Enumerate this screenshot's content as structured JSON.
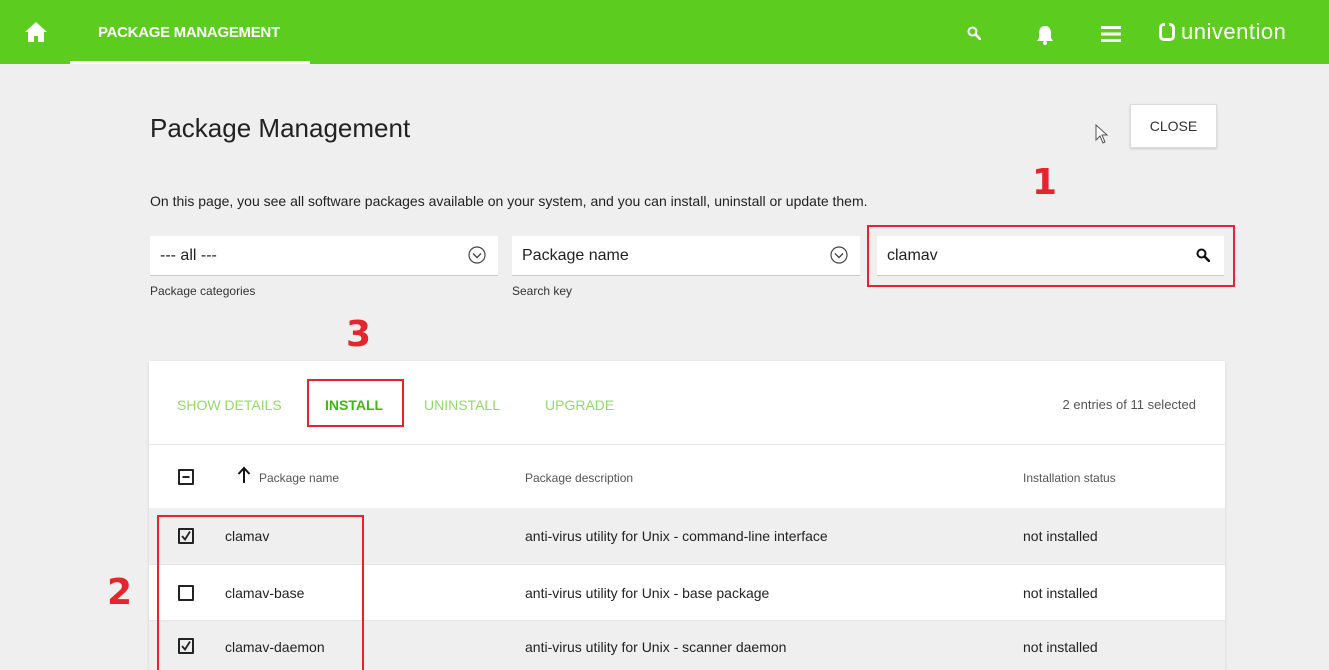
{
  "topbar": {
    "module_tab": "PACKAGE MANAGEMENT",
    "brand": "univention",
    "accent_color": "#5ccc1f",
    "icons": [
      "home-icon",
      "search-icon",
      "bell-icon",
      "menu-icon"
    ]
  },
  "page": {
    "title": "Package Management",
    "close_label": "CLOSE",
    "description": "On this page, you see all software packages available on your system, and you can install, uninstall or update them."
  },
  "filters": {
    "category": {
      "value": "--- all ---",
      "label": "Package categories"
    },
    "search_key": {
      "value": "Package name",
      "label": "Search key"
    },
    "search": {
      "value": "clamav"
    }
  },
  "annotations": {
    "step1": "1",
    "step2": "2",
    "step3": "3",
    "color": "#e2262b"
  },
  "toolbar": {
    "show_details": "SHOW DETAILS",
    "install": "INSTALL",
    "uninstall": "UNINSTALL",
    "upgrade": "UPGRADE",
    "selection_status": "2 entries of 11 selected"
  },
  "table": {
    "columns": [
      "Package name",
      "Package description",
      "Installation status"
    ],
    "rows": [
      {
        "name": "clamav",
        "description": "anti-virus utility for Unix - command-line interface",
        "status": "not installed",
        "checked": true
      },
      {
        "name": "clamav-base",
        "description": "anti-virus utility for Unix - base package",
        "status": "not installed",
        "checked": false
      },
      {
        "name": "clamav-daemon",
        "description": "anti-virus utility for Unix - scanner daemon",
        "status": "not installed",
        "checked": true
      }
    ]
  }
}
